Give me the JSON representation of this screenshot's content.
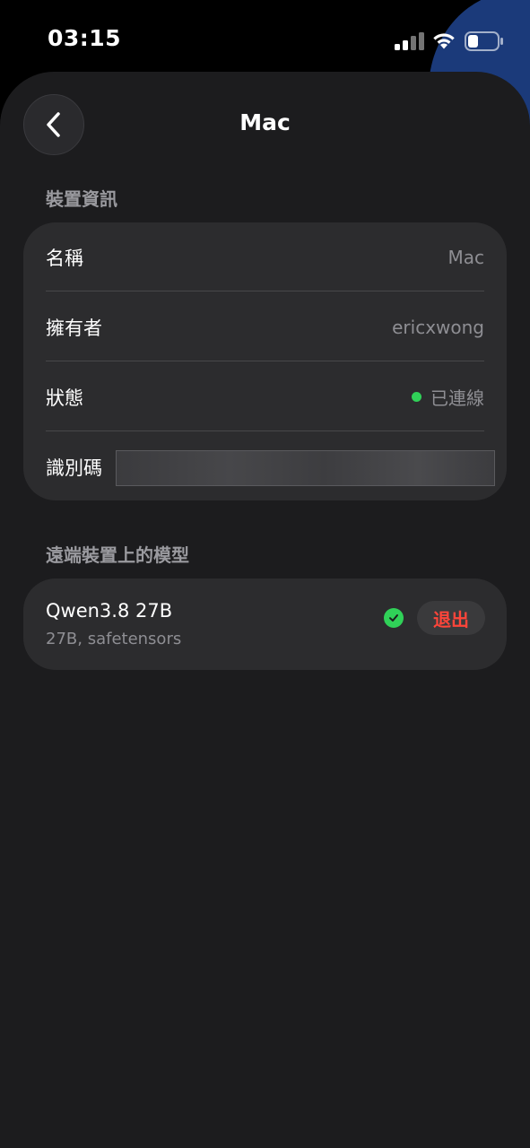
{
  "status_bar": {
    "time": "03:15",
    "icons": [
      "cellular-signal-icon",
      "wifi-icon",
      "battery-icon"
    ]
  },
  "nav": {
    "back_icon": "chevron-left-icon",
    "title": "Mac"
  },
  "device_info": {
    "section_title": "裝置資訊",
    "rows": [
      {
        "label": "名稱",
        "value": "Mac"
      },
      {
        "label": "擁有者",
        "value": "ericxwong"
      },
      {
        "label": "狀態",
        "value": "已連線",
        "indicator_color": "#30d158"
      },
      {
        "label": "識別碼",
        "value": ""
      }
    ]
  },
  "models": {
    "section_title": "遠端裝置上的模型",
    "items": [
      {
        "name": "Qwen3.8 27B",
        "meta": "27B, safetensors",
        "status_icon": "check-circle-icon",
        "action_label": "退出"
      }
    ]
  },
  "colors": {
    "accent_green": "#30d158",
    "danger_red": "#ff453a",
    "sheet_bg": "#1c1c1e",
    "card_bg": "#2c2c2e"
  }
}
